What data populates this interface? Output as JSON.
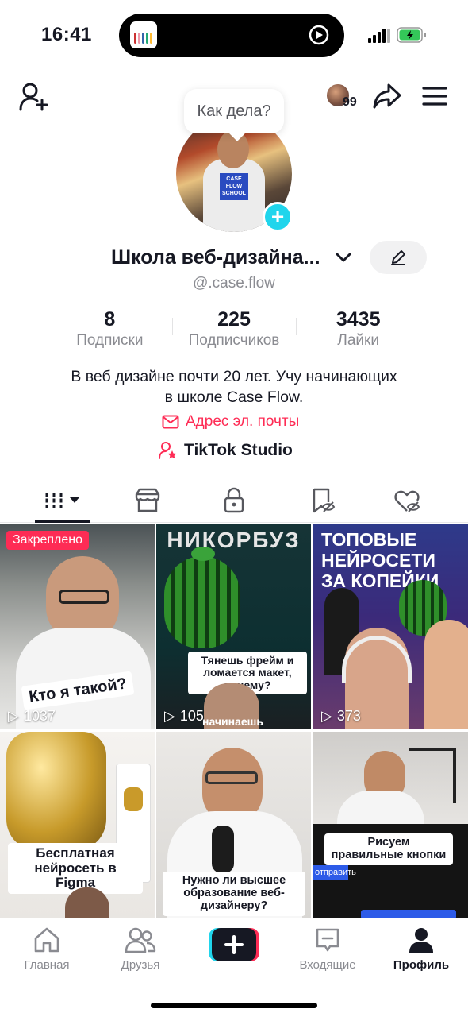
{
  "status_bar": {
    "time": "16:41"
  },
  "notifications": {
    "count": "99"
  },
  "bubble": {
    "text": "Как дела?"
  },
  "avatar": {
    "shirt_text": "CASE FLOW SCHOOL"
  },
  "profile": {
    "name": "Школа веб-дизайна...",
    "username": "@.case.flow",
    "stats": [
      {
        "value": "8",
        "label": "Подписки"
      },
      {
        "value": "225",
        "label": "Подписчиков"
      },
      {
        "value": "3435",
        "label": "Лайки"
      }
    ],
    "bio_line1": "В веб дизайне почти 20 лет. Учу начинающих",
    "bio_line2": "в школе Case Flow.",
    "email_label": "Адрес эл. почты",
    "studio_label": "TikTok Studio"
  },
  "videos": [
    {
      "pinned_label": "Закреплено",
      "caption": "Кто я такой?",
      "views": "1037"
    },
    {
      "title": "НИКОРБУЗ",
      "caption": "Тянешь фрейм и ломается макет, почему?",
      "subtitle": "начинаешь",
      "views": "105"
    },
    {
      "title": "ТОПОВЫЕ НЕЙРОСЕТИ ЗА КОПЕЙКИ",
      "views": "373"
    },
    {
      "caption": "Бесплатная нейросеть в Figma"
    },
    {
      "caption": "Нужно ли высшее образование веб-дизайнеру?"
    },
    {
      "caption": "Рисуем правильные кнопки",
      "button_text": "отправить"
    }
  ],
  "nav": {
    "home": "Главная",
    "friends": "Друзья",
    "inbox": "Входящие",
    "profile": "Профиль"
  },
  "colors": {
    "accent": "#fe2c55",
    "teal": "#20d5ec",
    "text": "#161823",
    "muted": "#8a8b91"
  }
}
